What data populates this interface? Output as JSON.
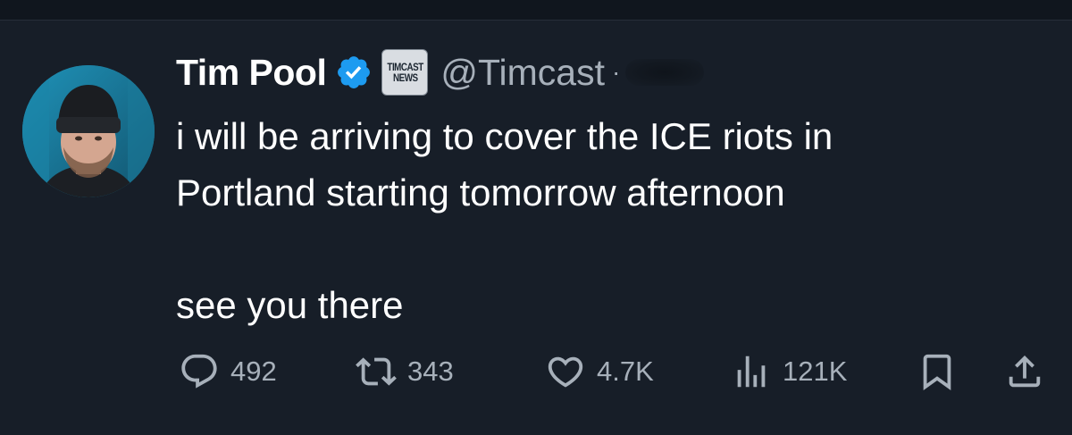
{
  "tweet": {
    "author_name": "Tim Pool",
    "handle": "@Timcast",
    "separator": "·",
    "affiliation_badge": {
      "line1": "TIMCAST",
      "line2": "NEWS"
    },
    "verified_icon": "blue-check-icon",
    "text": "i will be arriving to cover the ICE riots in\nPortland starting tomorrow afternoon\n\nsee you there"
  },
  "actions": {
    "replies": "492",
    "retweets": "343",
    "likes": "4.7K",
    "views": "121K"
  },
  "colors": {
    "background": "#171e28",
    "text_primary": "#ffffff",
    "text_secondary": "#a7b0ba",
    "verified_blue": "#1d9bf0"
  },
  "icons": [
    "reply-icon",
    "retweet-icon",
    "like-icon",
    "views-icon",
    "bookmark-icon",
    "share-icon"
  ]
}
